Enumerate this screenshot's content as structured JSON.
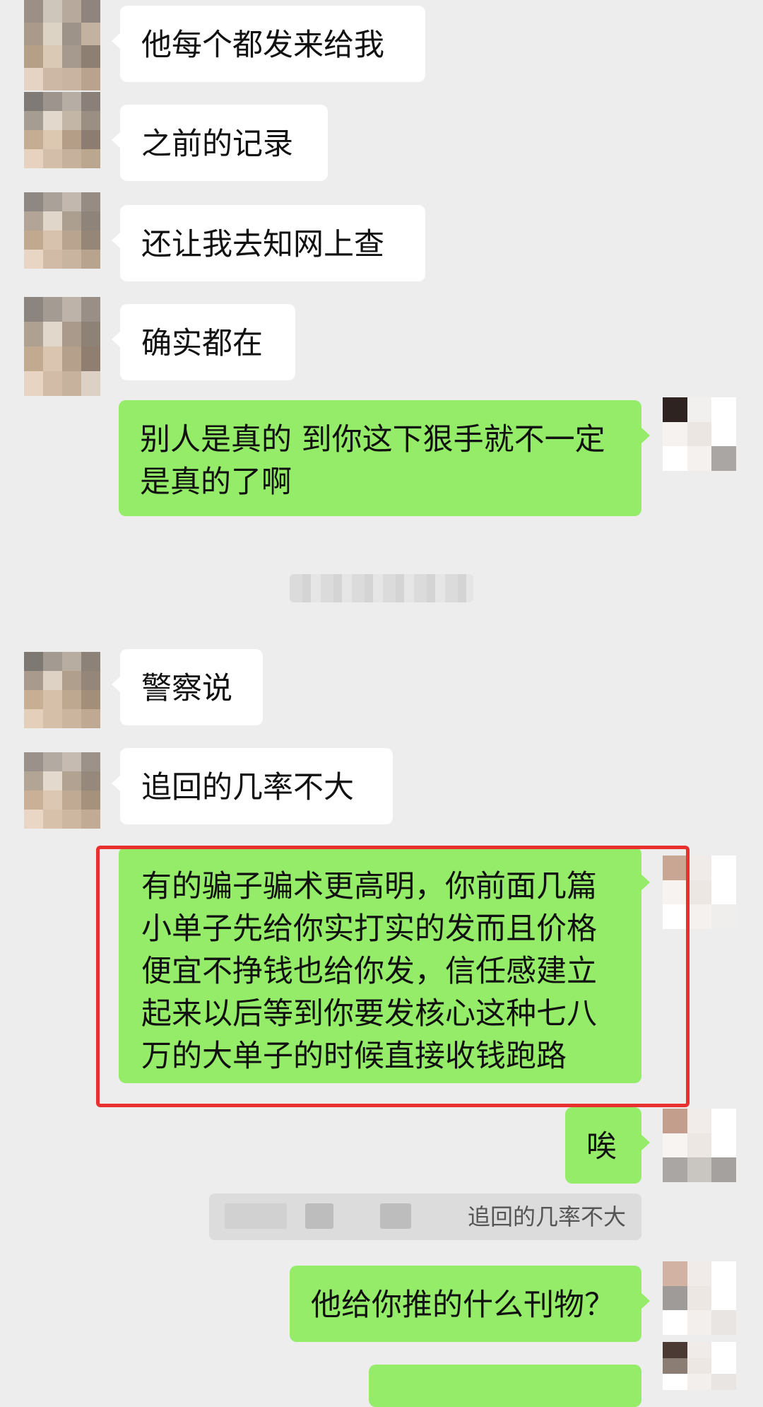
{
  "messages": [
    {
      "side": "left",
      "text": "他每个都发来给我"
    },
    {
      "side": "left",
      "text": "之前的记录"
    },
    {
      "side": "left",
      "text": "还让我去知网上查"
    },
    {
      "side": "left",
      "text": "确实都在"
    },
    {
      "side": "right",
      "text": "别人是真的 到你这下狠手就不一定是真的了啊"
    },
    {
      "side": "left",
      "text": "警察说"
    },
    {
      "side": "left",
      "text": "追回的几率不大"
    },
    {
      "side": "right",
      "text": "有的骗子骗术更高明，你前面几篇小单子先给你实打实的发而且价格便宜不挣钱也给你发，信任感建立起来以后等到你要发核心这种七八万的大单子的时候直接收钱跑路"
    },
    {
      "side": "right",
      "text": "唉"
    },
    {
      "side": "right",
      "text": "他给你推的什么刊物？"
    }
  ],
  "quote": {
    "text": "追回的几率不大"
  },
  "colors": {
    "background": "#ededed",
    "bubble_self": "#95ec69",
    "bubble_other": "#ffffff",
    "highlight": "#e8312f"
  }
}
